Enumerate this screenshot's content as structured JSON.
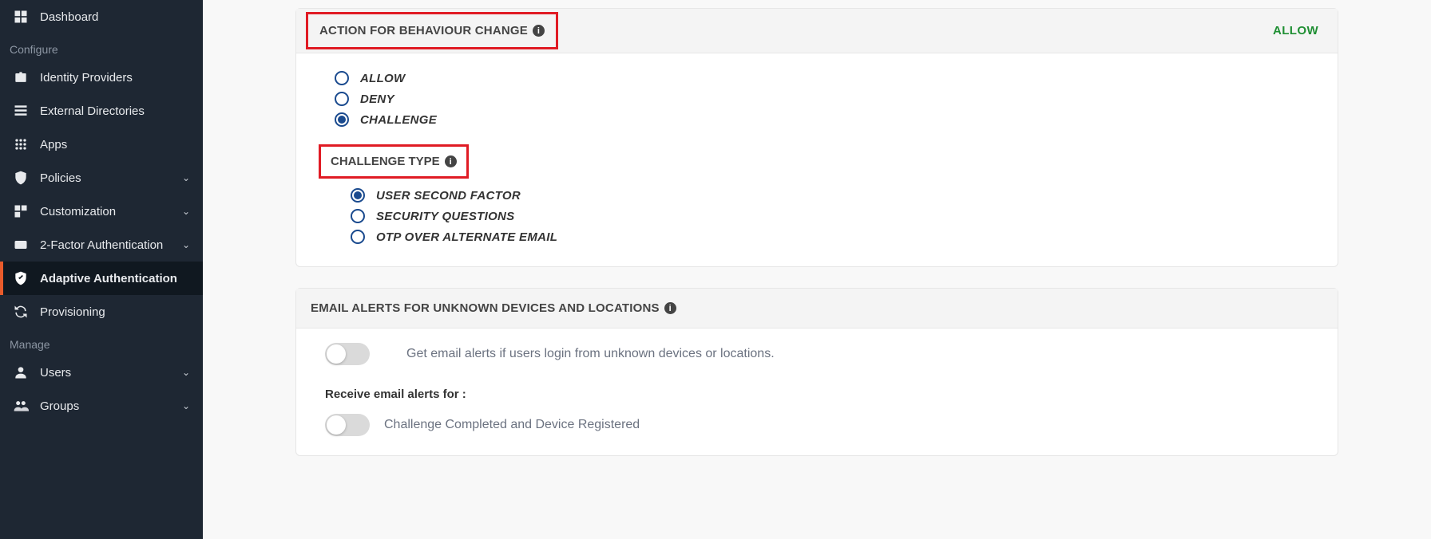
{
  "sidebar": {
    "section1": "Configure",
    "section2": "Manage",
    "items": [
      {
        "label": "Dashboard"
      },
      {
        "label": "Identity Providers"
      },
      {
        "label": "External Directories"
      },
      {
        "label": "Apps"
      },
      {
        "label": "Policies",
        "expand": true
      },
      {
        "label": "Customization",
        "expand": true
      },
      {
        "label": "2-Factor Authentication",
        "expand": true
      },
      {
        "label": "Adaptive Authentication",
        "active": true
      },
      {
        "label": "Provisioning"
      },
      {
        "label": "Users",
        "expand": true
      },
      {
        "label": "Groups",
        "expand": true
      }
    ]
  },
  "panel1": {
    "title": "ACTION FOR BEHAVIOUR CHANGE",
    "status": "ALLOW",
    "options": [
      "ALLOW",
      "DENY",
      "CHALLENGE"
    ],
    "selected": "CHALLENGE",
    "sub_title": "CHALLENGE TYPE",
    "sub_options": [
      "USER SECOND FACTOR",
      "SECURITY QUESTIONS",
      "OTP OVER ALTERNATE EMAIL"
    ],
    "sub_selected": "USER SECOND FACTOR"
  },
  "panel2": {
    "title": "EMAIL ALERTS FOR UNKNOWN DEVICES AND LOCATIONS",
    "toggle_text": "Get email alerts if users login from unknown devices or locations.",
    "sub_label": "Receive email alerts for :",
    "cc_text": "Challenge Completed and Device Registered"
  }
}
